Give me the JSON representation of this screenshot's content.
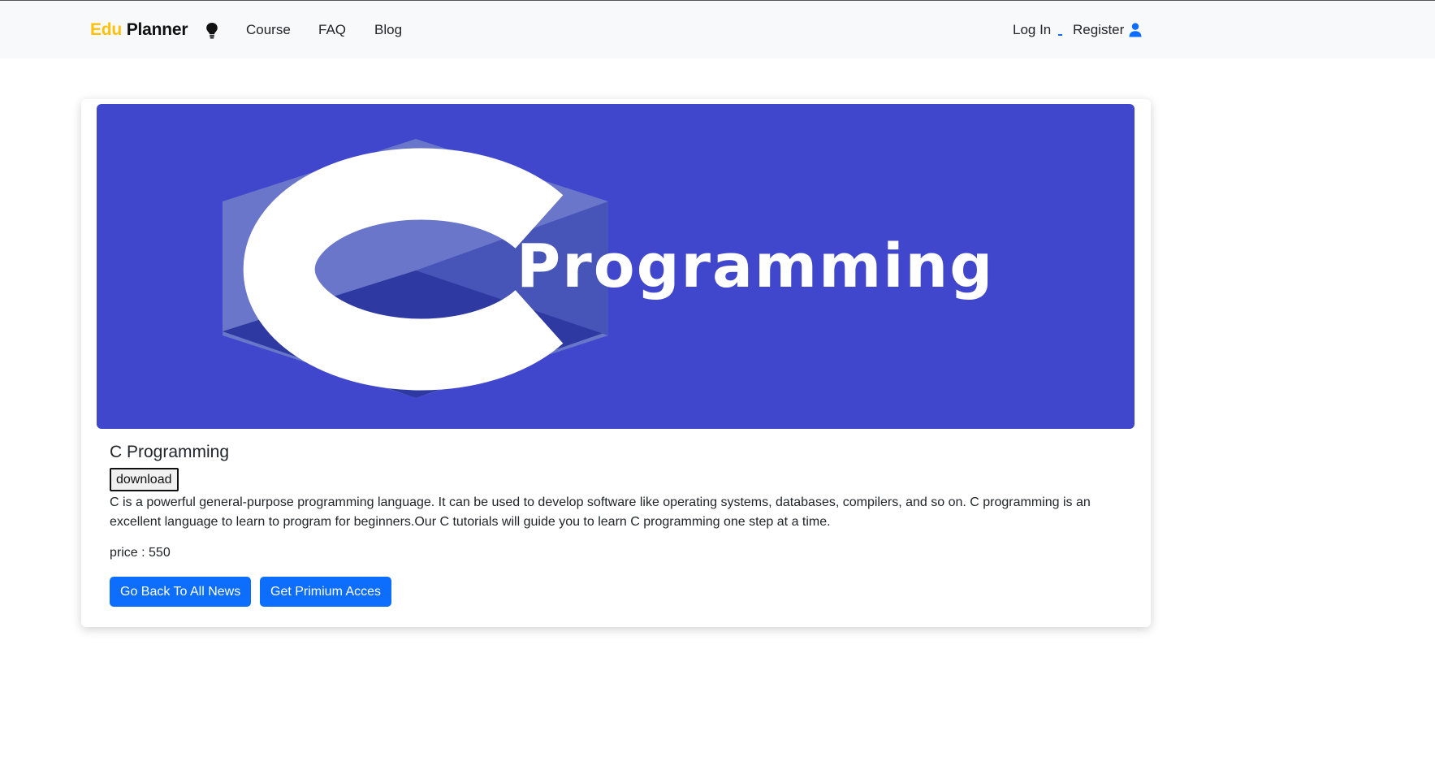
{
  "navbar": {
    "brand_part1": "Edu",
    "brand_part2": "Planner",
    "links": [
      "Course",
      "FAQ",
      "Blog"
    ],
    "login": "Log In",
    "register": "Register"
  },
  "course": {
    "banner_text": "Programming",
    "title": "C Programming",
    "download_label": "download",
    "description": "C is a powerful general-purpose programming language. It can be used to develop software like operating systems, databases, compilers, and so on. C programming is an excellent language to learn to program for beginners.Our C tutorials will guide you to learn C programming one step at a time.",
    "price_label": "price :",
    "price_value": "550",
    "back_button": "Go Back To All News",
    "premium_button": "Get Primium Acces"
  },
  "colors": {
    "brand_accent": "#ffc107",
    "primary": "#0d6efd",
    "banner_bg": "#4047cc"
  },
  "icons": {
    "bulb": "lightbulb-icon",
    "user": "user-icon"
  }
}
